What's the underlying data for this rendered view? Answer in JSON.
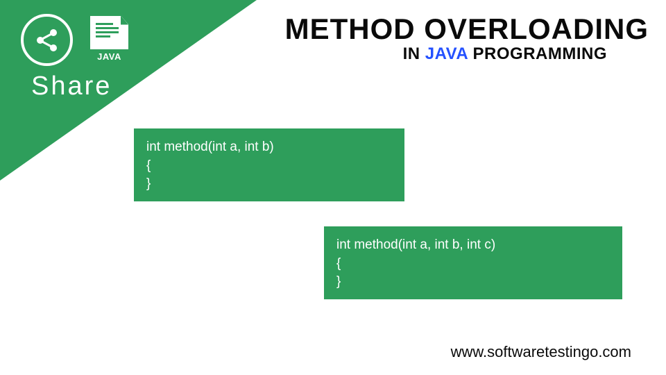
{
  "share": {
    "label": "Share",
    "java_badge": "JAVA"
  },
  "header": {
    "title": "METHOD OVERLOADING",
    "subtitle_prefix": "IN ",
    "subtitle_java": "JAVA",
    "subtitle_suffix": " PROGRAMMING"
  },
  "code": {
    "box1": {
      "line1": " int method(int a, int b)",
      "line2": "{",
      "line3": "}"
    },
    "box2": {
      "line1": " int method(int a, int b, int c)",
      "line2": "{",
      "line3": "}"
    }
  },
  "footer": {
    "url": "www.softwaretestingo.com"
  }
}
